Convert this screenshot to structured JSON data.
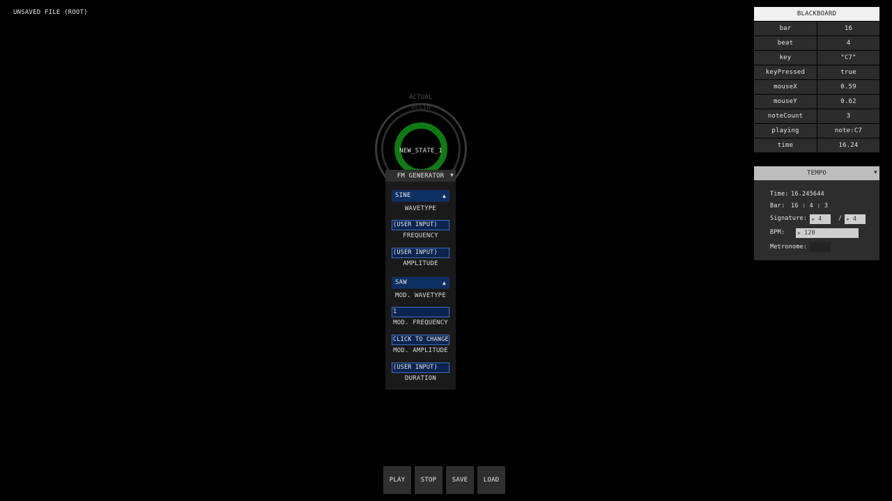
{
  "file_title": "UNSAVED FILE (ROOT)",
  "state": {
    "name": "NEW_STATE_1",
    "actual_label": "ACTUAL",
    "begin_label": "BEGIN"
  },
  "generator": {
    "title": "FM GENERATOR",
    "wavetype": {
      "value": "SINE",
      "label": "WAVETYPE"
    },
    "frequency": {
      "value": "(USER INPUT)",
      "label": "FREQUENCY"
    },
    "amplitude": {
      "value": "(USER INPUT)",
      "label": "AMPLITUDE"
    },
    "mod_wavetype": {
      "value": "SAW",
      "label": "MOD. WAVETYPE"
    },
    "mod_frequency": {
      "value": "1",
      "label": "MOD. FREQUENCY"
    },
    "mod_amplitude": {
      "value": "CLICK TO CHANGE",
      "label": "MOD. AMPLITUDE"
    },
    "duration": {
      "value": "(USER INPUT)",
      "label": "DURATION"
    }
  },
  "blackboard": {
    "title": "BLACKBOARD",
    "rows": [
      {
        "key": "bar",
        "value": "16"
      },
      {
        "key": "beat",
        "value": "4"
      },
      {
        "key": "key",
        "value": "\"C7\""
      },
      {
        "key": "keyPressed",
        "value": "true"
      },
      {
        "key": "mouseX",
        "value": "0.59"
      },
      {
        "key": "mouseY",
        "value": "0.62"
      },
      {
        "key": "noteCount",
        "value": "3"
      },
      {
        "key": "playing",
        "value": "note:C7"
      },
      {
        "key": "time",
        "value": "16.24"
      }
    ]
  },
  "tempo": {
    "title": "TEMPO",
    "time_label": "Time:",
    "time_value": "16.245644",
    "bar_label": "Bar:",
    "bar_value": "16 : 4 : 3",
    "signature_label": "Signature:",
    "signature_num": "4",
    "signature_sep": "/",
    "signature_den": "4",
    "bpm_label": "BPM:",
    "bpm_value": "120",
    "metronome_label": "Metronome:"
  },
  "buttons": {
    "play": "PLAY",
    "stop": "STOP",
    "save": "SAVE",
    "load": "LOAD"
  },
  "icons": {
    "dropdown_arrow": "triangle-down-icon",
    "select_arrow": "triangle-up-icon",
    "stepper": "triangle-right-icon"
  }
}
